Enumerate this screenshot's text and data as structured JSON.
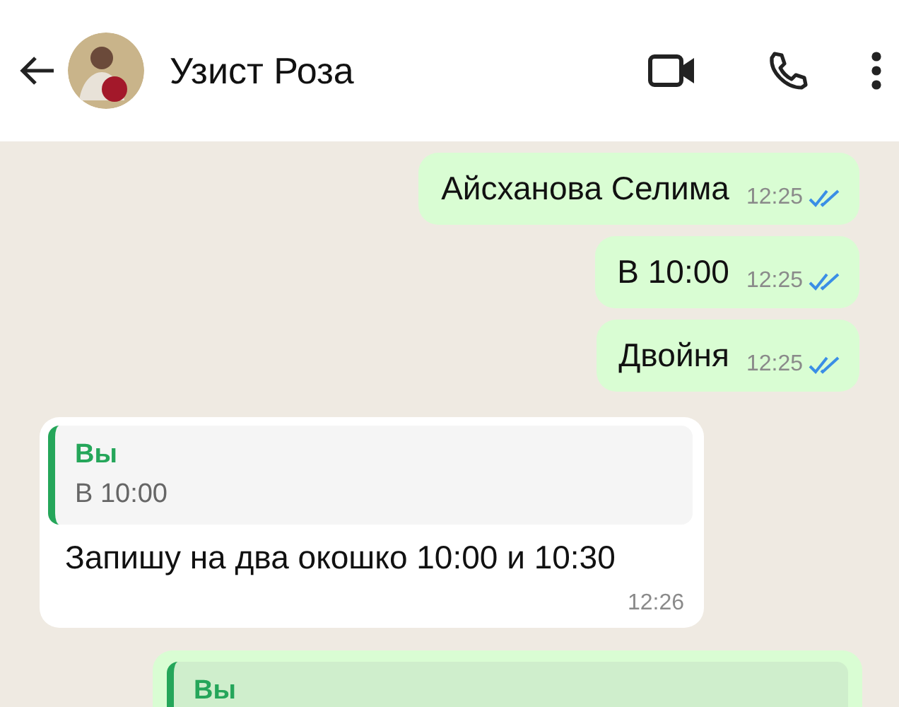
{
  "header": {
    "title": "Узист Роза"
  },
  "messages": [
    {
      "kind": "outgoing",
      "text": "Айсханова Селима",
      "time": "12:25",
      "read": true
    },
    {
      "kind": "outgoing",
      "text": "В 10:00",
      "time": "12:25",
      "read": true
    },
    {
      "kind": "outgoing",
      "text": "Двойня",
      "time": "12:25",
      "read": true
    },
    {
      "kind": "incoming",
      "quote": {
        "author": "Вы",
        "text": "В 10:00"
      },
      "text": "Запишу на два окошко 10:00 и 10:30",
      "time": "12:26"
    },
    {
      "kind": "outgoing",
      "quote": {
        "author": "Вы"
      }
    }
  ]
}
